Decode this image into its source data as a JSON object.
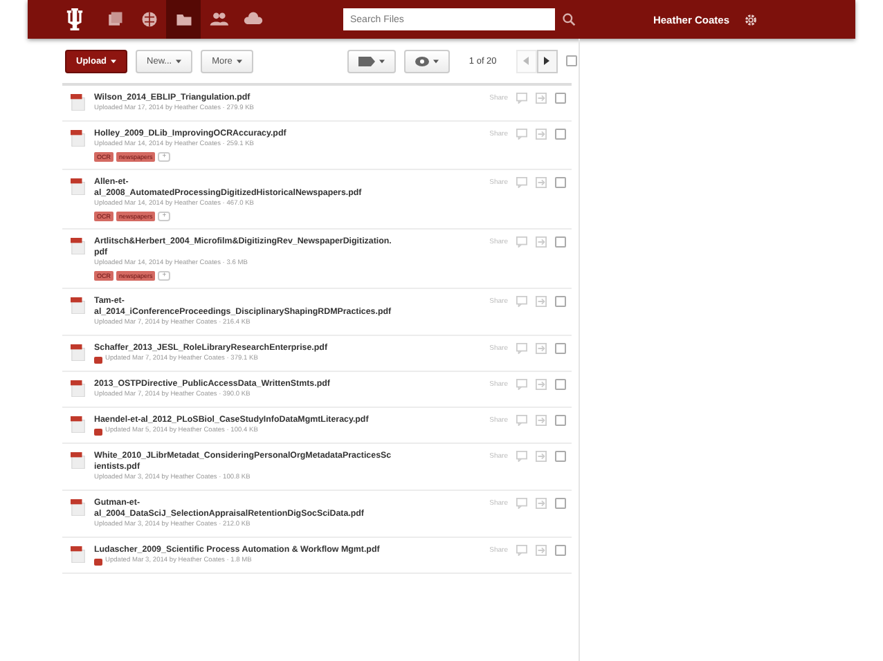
{
  "header": {
    "nav": [
      {
        "selected": false
      },
      {
        "selected": false
      },
      {
        "selected": true
      },
      {
        "selected": false
      },
      {
        "selected": false
      }
    ],
    "search": {
      "placeholder": "Search Files"
    },
    "user": "Heather Coates"
  },
  "toolbar": {
    "upload": "Upload",
    "new": "New...",
    "more": "More",
    "pager": "1 of 20",
    "prev_disabled": true,
    "select_all": false
  },
  "files": [
    {
      "name": "Wilson_2014_EBLIP_Triangulation.pdf",
      "kind": "uploaded",
      "meta": "Uploaded Mar 17, 2014 by Heather Coates · 279.9 KB",
      "share": "Share",
      "checked": false
    },
    {
      "name": "Holley_2009_DLib_ImprovingOCRAccuracy.pdf",
      "kind": "uploaded",
      "meta": "Uploaded Mar 14, 2014 by Heather Coates · 259.1 KB",
      "tags": [
        "OCR",
        "newspapers"
      ],
      "add_tag": "+",
      "share": "Share",
      "checked": false
    },
    {
      "name": "Allen-et-al_2008_AutomatedProcessingDigitizedHistoricalNewspapers.pdf",
      "kind": "uploaded",
      "meta": "Uploaded Mar 14, 2014 by Heather Coates · 467.0 KB",
      "tags": [
        "OCR",
        "newspapers"
      ],
      "add_tag": "+",
      "share": "Share",
      "checked": false
    },
    {
      "name": "Artlitsch&Herbert_2004_Microfilm&DigitizingRev_NewspaperDigitization.pdf",
      "kind": "uploaded",
      "meta": "Uploaded Mar 14, 2014 by Heather Coates · 3.6 MB",
      "tags": [
        "OCR",
        "newspapers"
      ],
      "add_tag": "+",
      "share": "Share",
      "checked": false
    },
    {
      "name": "Tam-et-al_2014_iConferenceProceedings_DisciplinaryShapingRDMPractices.pdf",
      "kind": "uploaded",
      "meta": "Uploaded Mar 7, 2014 by Heather Coates · 216.4 KB",
      "share": "Share",
      "checked": false
    },
    {
      "name": "Schaffer_2013_JESL_RoleLibraryResearchEnterprise.pdf",
      "kind": "updated",
      "meta": "Updated Mar 7, 2014 by Heather Coates · 379.1 KB",
      "share": "Share",
      "checked": false
    },
    {
      "name": "2013_OSTPDirective_PublicAccessData_WrittenStmts.pdf",
      "kind": "uploaded",
      "meta": "Uploaded Mar 7, 2014 by Heather Coates · 390.0 KB",
      "share": "Share",
      "checked": false
    },
    {
      "name": "Haendel-et-al_2012_PLoSBiol_CaseStudyInfoDataMgmtLiteracy.pdf",
      "kind": "updated",
      "meta": "Updated Mar 5, 2014 by Heather Coates · 100.4 KB",
      "share": "Share",
      "checked": false
    },
    {
      "name": "White_2010_JLibrMetadat_ConsideringPersonalOrgMetadataPracticesScientists.pdf",
      "kind": "uploaded",
      "meta": "Uploaded Mar 3, 2014 by Heather Coates · 100.8 KB",
      "share": "Share",
      "checked": false
    },
    {
      "name": "Gutman-et-al_2004_DataSciJ_SelectionAppraisalRetentionDigSocSciData.pdf",
      "kind": "uploaded",
      "meta": "Uploaded Mar 3, 2014 by Heather Coates · 212.0 KB",
      "share": "Share",
      "checked": false
    },
    {
      "name": "Ludascher_2009_Scientific Process Automation & Workflow Mgmt.pdf",
      "kind": "updated",
      "meta": "Updated Mar 3, 2014 by Heather Coates · 1.8 MB",
      "share": "Share",
      "checked": false
    }
  ]
}
